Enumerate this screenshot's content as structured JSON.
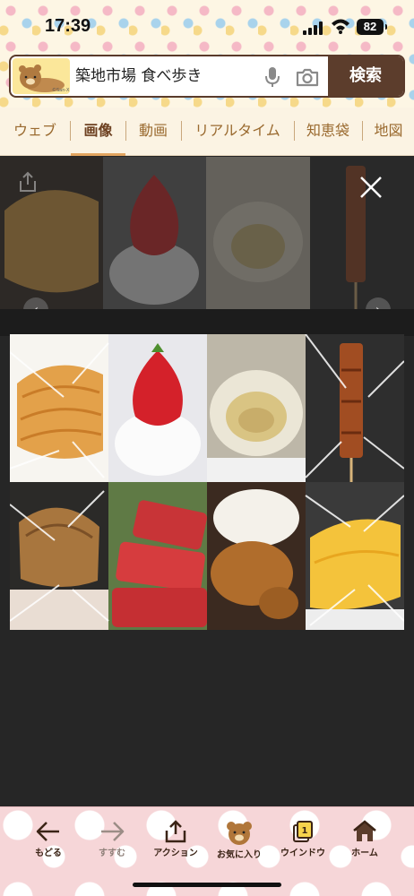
{
  "status": {
    "time": "17:39",
    "battery": "82"
  },
  "search": {
    "query": "築地市場 食べ歩き",
    "button_label": "検索",
    "logo_credit": "©San-X"
  },
  "tabs": [
    {
      "label": "ウェブ"
    },
    {
      "label": "画像"
    },
    {
      "label": "動画"
    },
    {
      "label": "リアルタイム"
    },
    {
      "label": "知恵袋"
    },
    {
      "label": "地図"
    }
  ],
  "active_tab": "画像",
  "viewer": {
    "thumbnails": [
      {
        "name": "dashimaki-tamago"
      },
      {
        "name": "strawberry-daifuku"
      },
      {
        "name": "grilled-oyster"
      },
      {
        "name": "unagi-skewer"
      },
      {
        "name": "fried-snack"
      },
      {
        "name": "tuna-sashimi"
      },
      {
        "name": "menchi-katsu-rice"
      },
      {
        "name": "tamagoyaki"
      }
    ]
  },
  "toolbar": {
    "back_label": "もどる",
    "forward_label": "すすむ",
    "action_label": "アクション",
    "favorites_label": "お気に入り",
    "window_label": "ウインドウ",
    "window_count": "1",
    "home_label": "ホーム"
  },
  "colors": {
    "brand_brown": "#5c3d2c",
    "tab_text": "#9a6a2f",
    "toolbar_pink": "#f6d6d8"
  }
}
